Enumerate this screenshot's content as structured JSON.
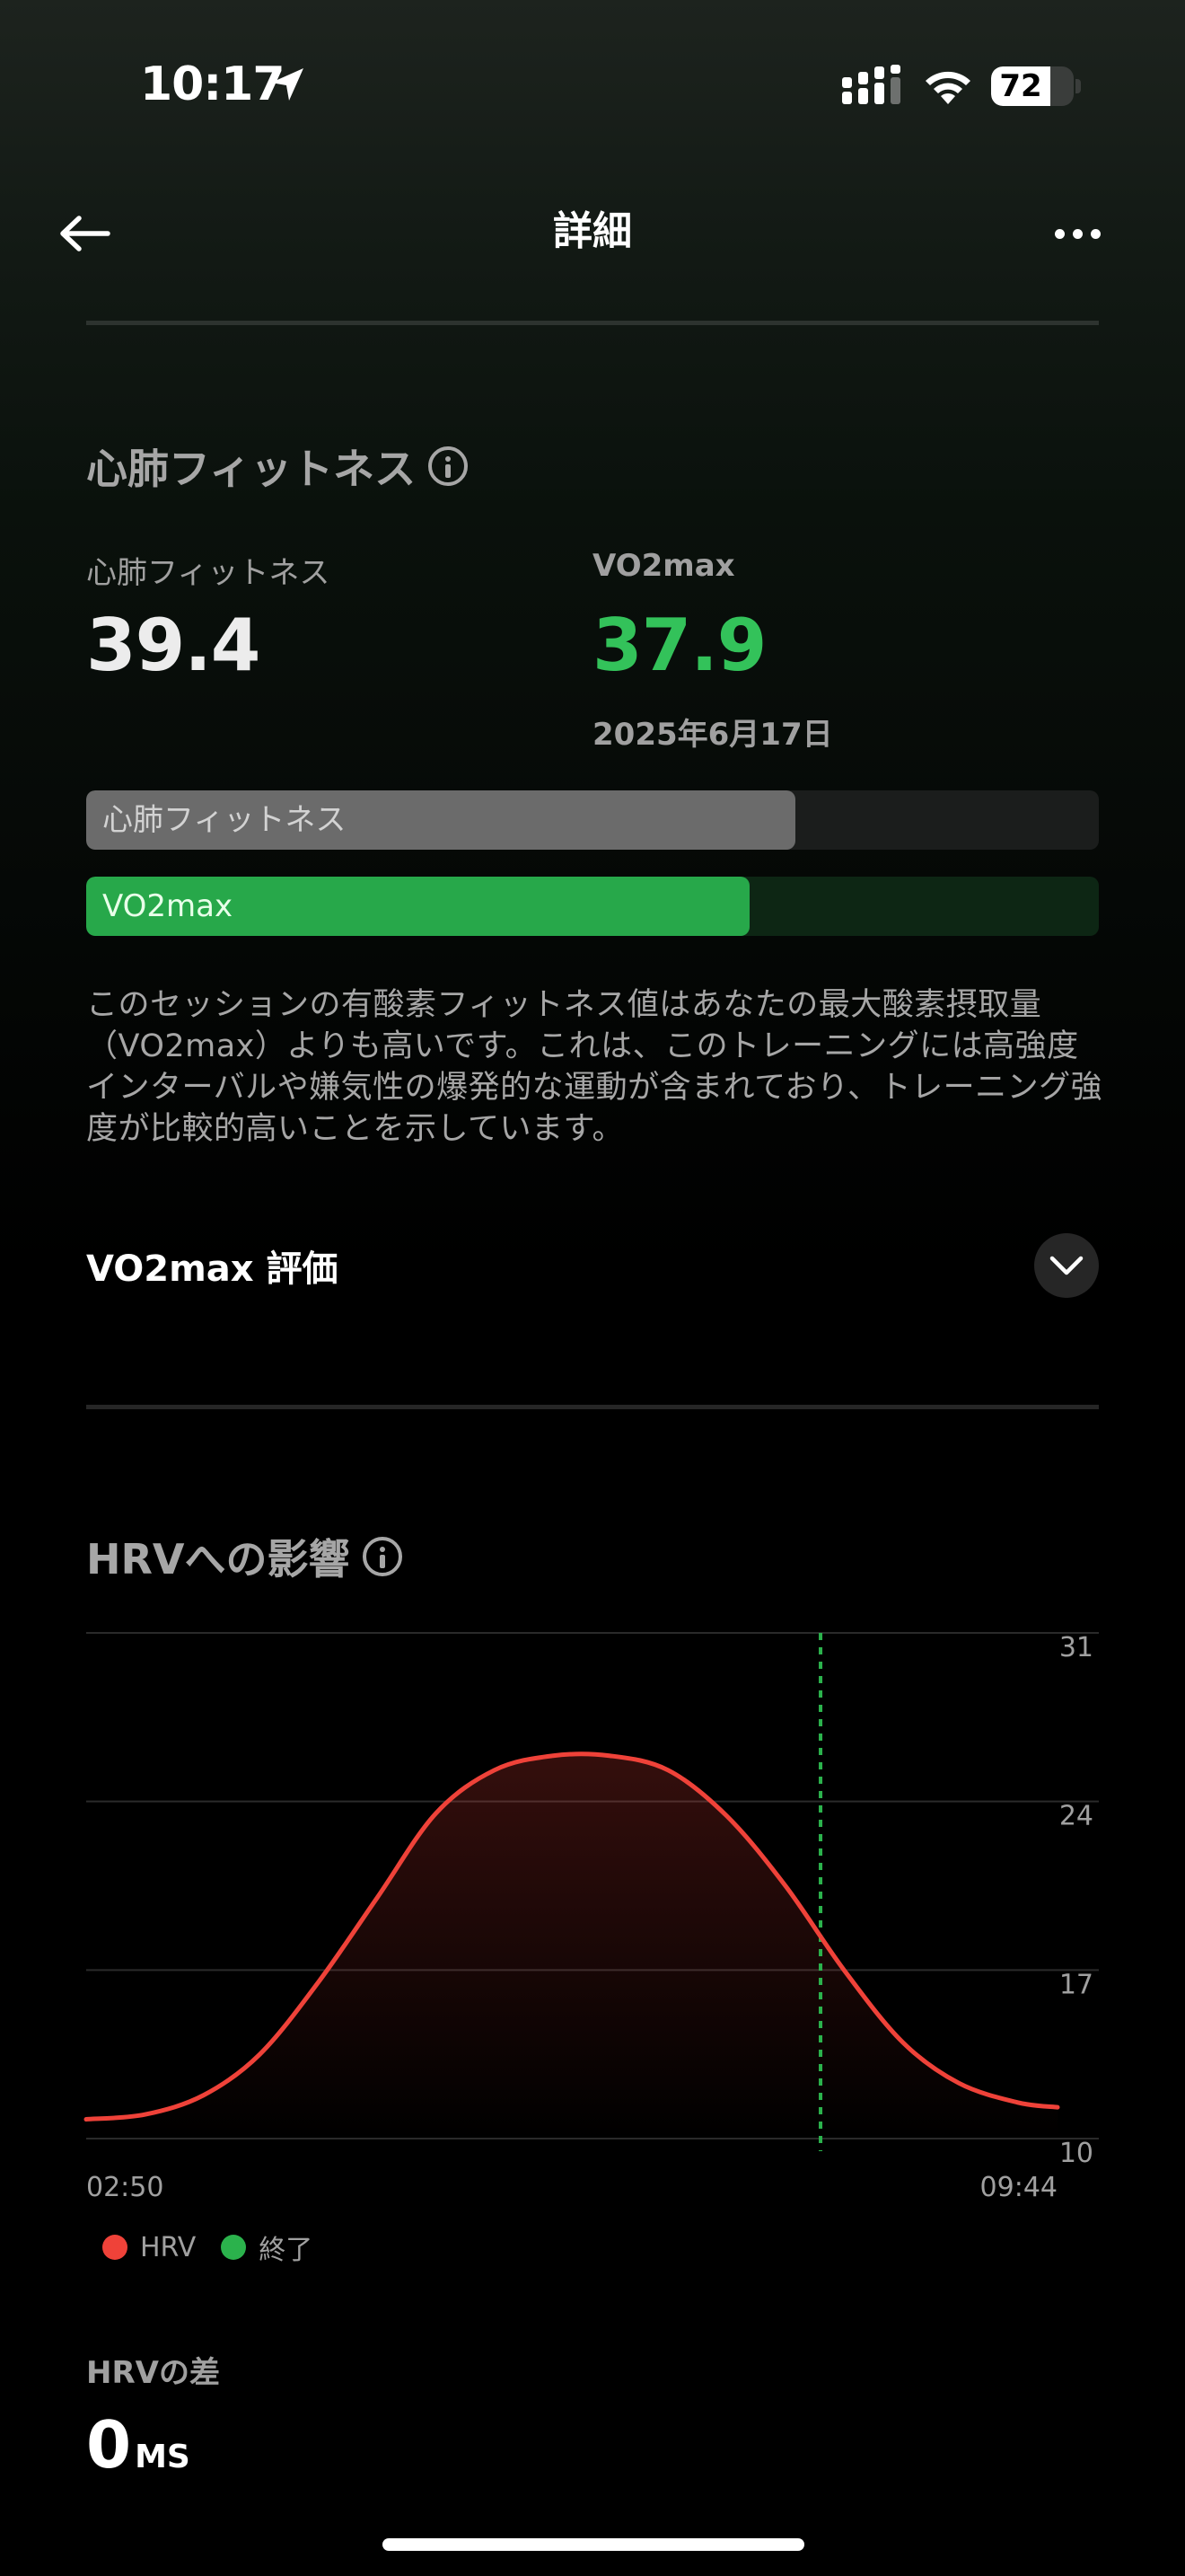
{
  "status_bar": {
    "time": "10:17",
    "battery": "72",
    "battery_level_percent": 72,
    "icons": [
      "location-arrow-icon",
      "cellular-signal-icon",
      "wifi-icon",
      "battery-icon"
    ]
  },
  "nav": {
    "title": "詳細",
    "back_icon": "arrow-left-icon",
    "more_icon": "ellipsis-icon"
  },
  "cardio": {
    "section_title": "心肺フィットネス",
    "fitness_label": "心肺フィットネス",
    "fitness_value": "39.4",
    "vo2_label": "VO2max",
    "vo2_value": "37.9",
    "vo2_date": "2025年6月17日",
    "bars": [
      {
        "label": "心肺フィットネス",
        "fill_fraction": 0.7,
        "color": "#6b6b6b",
        "track_color": "#1b1d1c"
      },
      {
        "label": "VO2max",
        "fill_fraction": 0.655,
        "color": "#27a84a",
        "track_color": "#0d2614"
      }
    ],
    "description": "このセッションの有酸素フィットネス値はあなたの最大酸素摂取量（VO2max）よりも高いです。これは、このトレーニングには高強度インターバルや嫌気性の爆発的な運動が含まれており、トレーニング強度が比較的高いことを示しています。",
    "accordion_title": "VO2max 評価",
    "accordion_icon": "chevron-down-icon"
  },
  "hrv": {
    "section_title": "HRVへの影響",
    "diff_label": "HRVの差",
    "diff_value": "0",
    "diff_unit": "MS"
  },
  "colors": {
    "hrv_line": "#ef4239",
    "end_marker": "#2bb24c",
    "vo2_green": "#33c25a"
  },
  "chart_data": {
    "type": "line",
    "title": "",
    "xlabel": "",
    "ylabel": "",
    "x_range": [
      "02:50",
      "09:44"
    ],
    "x_tick_labels": [
      "02:50",
      "09:44"
    ],
    "ylim": [
      10,
      31
    ],
    "y_ticks": [
      31,
      24,
      17,
      10
    ],
    "grid": true,
    "y_axis_position": "right",
    "legend_placement": "bottom-left",
    "series": [
      {
        "name": "HRV",
        "color": "#ef4239",
        "x": [
          "02:50",
          "03:15",
          "03:40",
          "04:04",
          "04:29",
          "04:54",
          "05:19",
          "05:44",
          "06:09",
          "06:33",
          "06:58",
          "07:23",
          "07:48",
          "08:13",
          "08:38",
          "09:02",
          "09:27",
          "09:44"
        ],
        "y": [
          10.8,
          11.0,
          11.8,
          13.5,
          16.5,
          20.0,
          23.5,
          25.3,
          25.9,
          25.9,
          25.3,
          23.4,
          20.5,
          17.0,
          14.0,
          12.3,
          11.5,
          11.3
        ]
      }
    ],
    "markers": [
      {
        "name": "終了",
        "color": "#2bb24c",
        "x": "08:03",
        "style": "dashed-vertical"
      }
    ]
  }
}
